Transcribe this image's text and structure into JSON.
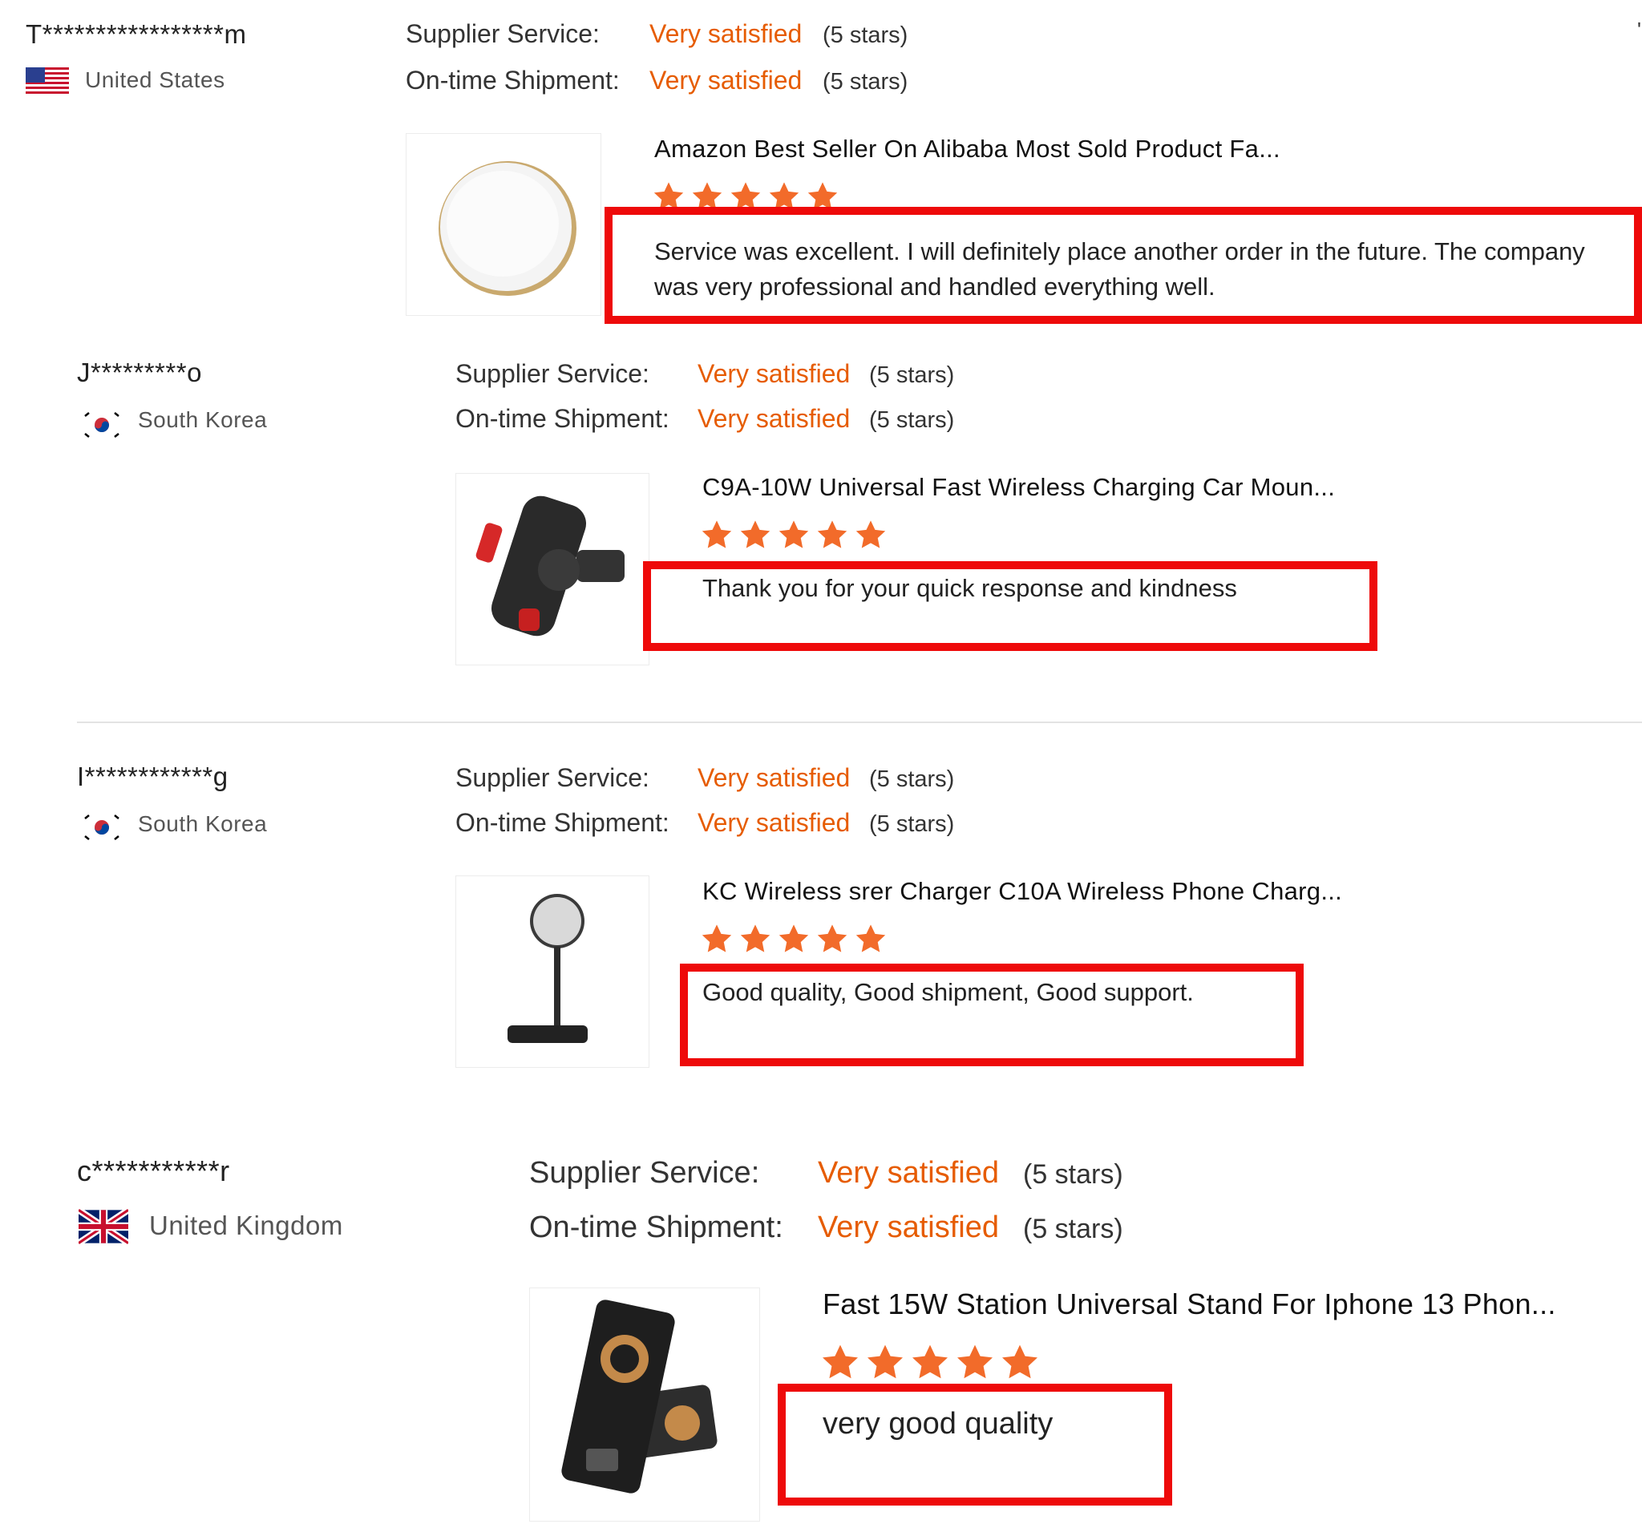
{
  "reviews": [
    {
      "user": "T*****************m",
      "country": "United States",
      "flag_icon": "us-flag-icon",
      "supplier_label": "Supplier Service:",
      "supplier_value": "Very satisfied",
      "supplier_stars": "(5 stars)",
      "shipment_label": "On-time Shipment:",
      "shipment_value": "Very satisfied",
      "shipment_stars": "(5 stars)",
      "product": "Amazon Best Seller On Alibaba Most Sold Product Fa...",
      "rating": 5,
      "comment": "Service was excellent. I will definitely place another order in the future. The company was very professional and handled everything well."
    },
    {
      "user": "J*********o",
      "country": "South Korea",
      "flag_icon": "kr-flag-icon",
      "supplier_label": "Supplier Service:",
      "supplier_value": "Very satisfied",
      "supplier_stars": "(5 stars)",
      "shipment_label": "On-time Shipment:",
      "shipment_value": "Very satisfied",
      "shipment_stars": "(5 stars)",
      "product": "C9A-10W Universal Fast Wireless Charging Car Moun...",
      "rating": 5,
      "comment": "Thank you for your quick response and kindness"
    },
    {
      "user": "I************g",
      "country": "South Korea",
      "flag_icon": "kr-flag-icon",
      "supplier_label": "Supplier Service:",
      "supplier_value": "Very satisfied",
      "supplier_stars": "(5 stars)",
      "shipment_label": "On-time Shipment:",
      "shipment_value": "Very satisfied",
      "shipment_stars": "(5 stars)",
      "product": "KC Wireless srer Charger C10A Wireless Phone Charg...",
      "rating": 5,
      "comment": "Good quality, Good shipment, Good support."
    },
    {
      "user": "c***********r",
      "country": "United Kingdom",
      "flag_icon": "uk-flag-icon",
      "supplier_label": "Supplier Service:",
      "supplier_value": "Very satisfied",
      "supplier_stars": "(5 stars)",
      "shipment_label": "On-time Shipment:",
      "shipment_value": "Very satisfied",
      "shipment_stars": "(5 stars)",
      "product": "Fast 15W Station Universal Stand For Iphone 13 Phon...",
      "rating": 5,
      "comment": "very good quality"
    }
  ],
  "colors": {
    "satisfied": "#e65c00",
    "star": "#f26b2a",
    "highlight_box": "#ee0a0a"
  }
}
